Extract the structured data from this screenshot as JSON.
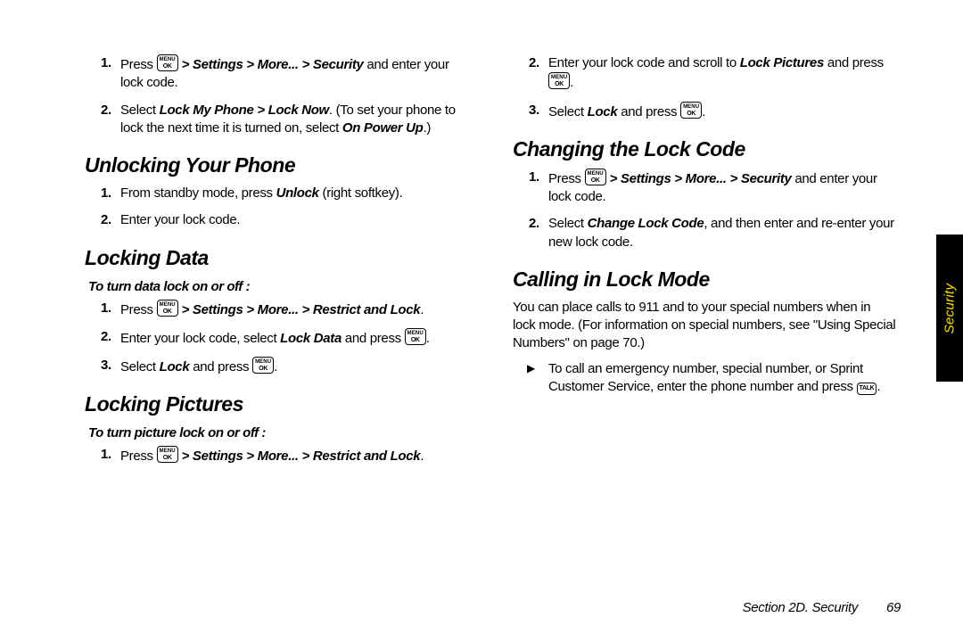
{
  "keys": {
    "menu_ok_top": "MENU",
    "menu_ok_bot": "OK",
    "talk": "TALK"
  },
  "tab": {
    "label": "Security"
  },
  "footer": {
    "section": "Section 2D. Security",
    "page": "69"
  },
  "left": {
    "top_steps": [
      {
        "num": "1.",
        "pre": "Press ",
        "path": " > Settings > More... > Security",
        "post": " and enter your lock code.",
        "key": "menu_ok"
      },
      {
        "num": "2.",
        "text1": "Select ",
        "bi1": "Lock My Phone > Lock Now",
        "text2": ". (To set your phone to lock the next time it is turned on, select ",
        "bi2": "On Power Up",
        "text3": ".)"
      }
    ],
    "unlocking": {
      "heading": "Unlocking Your Phone",
      "steps": [
        {
          "num": "1.",
          "text1": "From standby mode, press ",
          "bi1": "Unlock",
          "text2": " (right softkey)."
        },
        {
          "num": "2.",
          "text1": "Enter your lock code."
        }
      ]
    },
    "locking_data": {
      "heading": "Locking Data",
      "lead": "To turn data lock on or off :",
      "steps": [
        {
          "num": "1.",
          "pre": "Press ",
          "path": " > Settings > More... > Restrict and Lock",
          "post": ".",
          "key": "menu_ok"
        },
        {
          "num": "2.",
          "text1": "Enter your lock code, select ",
          "bi1": "Lock Data",
          "text2": " and press ",
          "key_after": "menu_ok",
          "text3": "."
        },
        {
          "num": "3.",
          "text1": "Select ",
          "bi1": "Lock",
          "text2": " and press ",
          "key_after": "menu_ok",
          "text3": "."
        }
      ]
    },
    "locking_pictures": {
      "heading": "Locking Pictures",
      "lead": "To turn picture lock on or off :",
      "steps": [
        {
          "num": "1.",
          "pre": "Press ",
          "path": " > Settings > More... > Restrict and Lock",
          "post": ".",
          "key": "menu_ok"
        }
      ]
    }
  },
  "right": {
    "top_steps": [
      {
        "num": "2.",
        "text1": "Enter your lock code and scroll to ",
        "bi1": "Lock Pictures",
        "text2": " and press ",
        "key_after": "menu_ok",
        "text3": "."
      },
      {
        "num": "3.",
        "text1": "Select ",
        "bi1": "Lock",
        "text2": " and press ",
        "key_after": "menu_ok",
        "text3": "."
      }
    ],
    "changing": {
      "heading": "Changing the Lock Code",
      "steps": [
        {
          "num": "1.",
          "pre": "Press ",
          "path": " > Settings > More... > Security",
          "post": " and enter your lock code.",
          "key": "menu_ok"
        },
        {
          "num": "2.",
          "text1": "Select ",
          "bi1": "Change Lock Code",
          "text2": ", and then enter and re-enter your new lock code."
        }
      ]
    },
    "calling": {
      "heading": "Calling in Lock Mode",
      "para": "You can place calls to 911 and to your special numbers when in lock mode. (For information on special numbers, see \"Using Special Numbers\" on page 70.)",
      "bullets": [
        {
          "text1": "To call an emergency number, special number, or Sprint Customer Service, enter the phone number and press ",
          "key_after": "talk",
          "text3": "."
        }
      ]
    }
  }
}
